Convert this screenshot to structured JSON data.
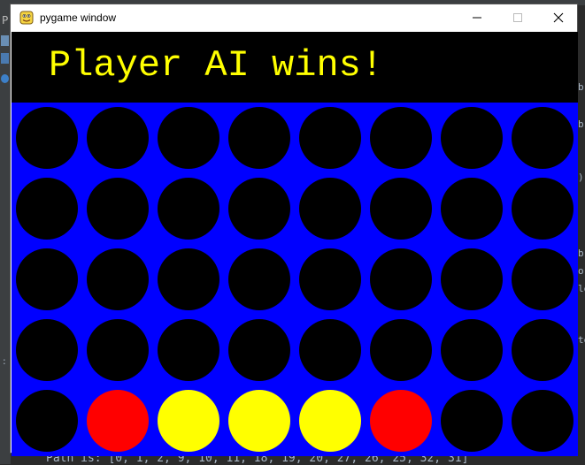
{
  "background_ide": {
    "left_label": "P",
    "left_colon": ":",
    "bottom_text": "Path is: [0, 1, 2, 9, 10, 11, 18, 19, 20, 27, 26, 25, 32, 31]",
    "right_fragments": [
      "b",
      "b",
      ")",
      "b",
      "o",
      "le",
      "te"
    ]
  },
  "window": {
    "title": "pygame window",
    "icon": "pygame-snake-icon",
    "controls": {
      "minimize": "minimize-icon",
      "maximize": "maximize-icon",
      "close": "close-icon"
    }
  },
  "game": {
    "message": "Player AI wins!",
    "colors": {
      "board": "#0000ff",
      "empty": "#000000",
      "player": "#ff0000",
      "ai": "#ffff00",
      "message": "#ffff00"
    },
    "rows": 5,
    "cols": 8,
    "grid": [
      [
        "empty",
        "empty",
        "empty",
        "empty",
        "empty",
        "empty",
        "empty",
        "empty"
      ],
      [
        "empty",
        "empty",
        "empty",
        "empty",
        "empty",
        "empty",
        "empty",
        "empty"
      ],
      [
        "empty",
        "empty",
        "empty",
        "empty",
        "empty",
        "empty",
        "empty",
        "empty"
      ],
      [
        "empty",
        "empty",
        "empty",
        "empty",
        "empty",
        "empty",
        "empty",
        "empty"
      ],
      [
        "empty",
        "player",
        "ai",
        "ai",
        "ai",
        "player",
        "empty",
        "empty"
      ]
    ]
  }
}
